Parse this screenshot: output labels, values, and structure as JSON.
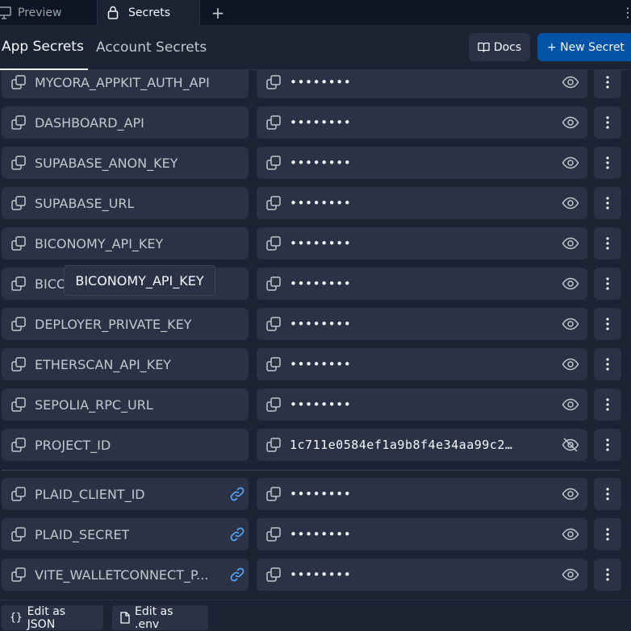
{
  "tabs": {
    "preview_label": "Preview",
    "secrets_label": "Secrets",
    "add_label": "+"
  },
  "subtabs": {
    "app_label": "App Secrets",
    "account_label": "Account Secrets"
  },
  "toolbar": {
    "docs_label": "Docs",
    "new_secret_label": "+ New Secret"
  },
  "secrets": [
    {
      "key": "MYCORA_APPKIT_AUTH_API",
      "value": "••••••••",
      "revealed": false,
      "linked": false
    },
    {
      "key": "DASHBOARD_API",
      "value": "••••••••",
      "revealed": false,
      "linked": false
    },
    {
      "key": "SUPABASE_ANON_KEY",
      "value": "••••••••",
      "revealed": false,
      "linked": false
    },
    {
      "key": "SUPABASE_URL",
      "value": "••••••••",
      "revealed": false,
      "linked": false
    },
    {
      "key": "BICONOMY_API_KEY",
      "value": "••••••••",
      "revealed": false,
      "linked": false
    },
    {
      "key": "BICONOMY_API_KEY",
      "value": "••••••••",
      "revealed": false,
      "linked": false
    },
    {
      "key": "DEPLOYER_PRIVATE_KEY",
      "value": "••••••••",
      "revealed": false,
      "linked": false
    },
    {
      "key": "ETHERSCAN_API_KEY",
      "value": "••••••••",
      "revealed": false,
      "linked": false
    },
    {
      "key": "SEPOLIA_RPC_URL",
      "value": "••••••••",
      "revealed": false,
      "linked": false
    },
    {
      "key": "PROJECT_ID",
      "value": "1c711e0584ef1a9b8f4e34aa99c2…",
      "revealed": true,
      "linked": false
    },
    {
      "key": "PLAID_CLIENT_ID",
      "value": "••••••••",
      "revealed": false,
      "linked": true
    },
    {
      "key": "PLAID_SECRET",
      "value": "••••••••",
      "revealed": false,
      "linked": true
    },
    {
      "key": "VITE_WALLETCONNECT_P...",
      "value": "••••••••",
      "revealed": false,
      "linked": true
    }
  ],
  "tooltip": {
    "text": "BICONOMY_API_KEY"
  },
  "footer": {
    "edit_json_label": "Edit as JSON",
    "edit_env_label": "Edit as .env"
  },
  "colors": {
    "background": "#1c2333",
    "tabbar": "#0e1525",
    "surface": "#2b3245",
    "primary_button": "#0053a6",
    "link_icon": "#57abff",
    "text": "#f5f9fc"
  },
  "icons": {
    "preview_tab": "monitor-icon",
    "secrets_tab": "lock-icon",
    "docs": "book-icon",
    "copy": "copy-icon",
    "reveal": "eye-icon",
    "hide": "eye-off-icon",
    "linked": "link-icon",
    "menu": "kebab-menu-icon",
    "json": "braces-icon",
    "env": "file-icon"
  }
}
